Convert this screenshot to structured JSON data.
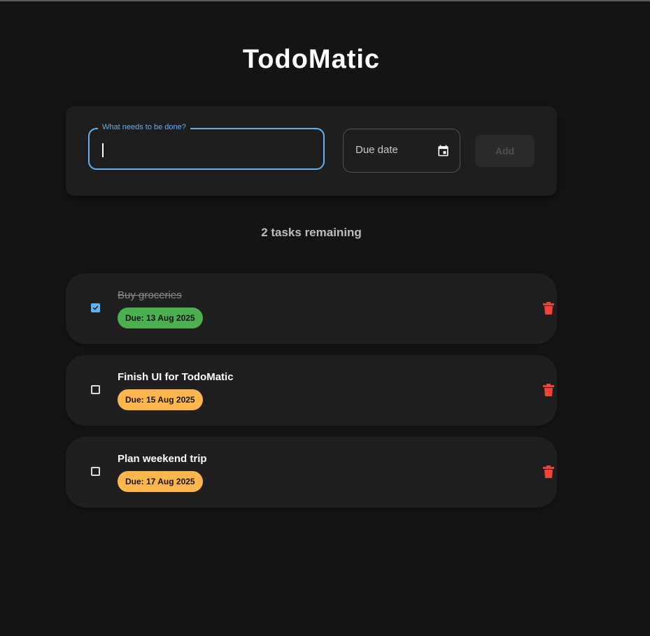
{
  "app": {
    "title": "TodoMatic"
  },
  "form": {
    "task_label": "What needs to be done?",
    "task_value": "",
    "due_placeholder": "Due date",
    "add_label": "Add",
    "calendar_icon": "calendar-icon"
  },
  "summary": {
    "remaining_text": "2 tasks remaining"
  },
  "tasks": [
    {
      "text": "Buy groceries",
      "completed": true,
      "due": "Due: 13 Aug 2025",
      "badge_color": "#4caf50"
    },
    {
      "text": "Finish UI for TodoMatic",
      "completed": false,
      "due": "Due: 15 Aug 2025",
      "badge_color": "#ffb74d"
    },
    {
      "text": "Plan weekend trip",
      "completed": false,
      "due": "Due: 17 Aug 2025",
      "badge_color": "#ffb74d"
    }
  ],
  "colors": {
    "background": "#141416",
    "card": "#1e1e1f",
    "accent": "#64b1f0",
    "delete": "#f44336",
    "done_badge": "#4caf50",
    "pending_badge": "#ffb74d"
  },
  "icons": {
    "delete": "trash-icon",
    "check": "checkmark-icon"
  }
}
